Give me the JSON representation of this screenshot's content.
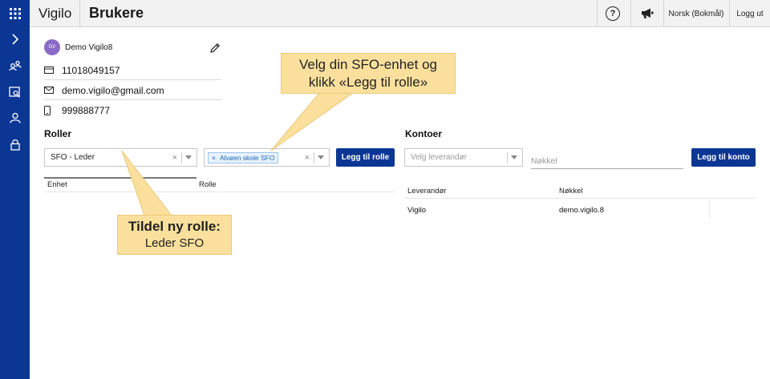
{
  "app": {
    "brand": "Vigilo",
    "page_title": "Brukere"
  },
  "topbar": {
    "help_label": "?",
    "language": "Norsk (Bokmål)",
    "logout": "Logg ut"
  },
  "profile": {
    "initials": "DV",
    "name": "Demo Vigilo8",
    "id_number": "11018049157",
    "email": "demo.vigilo@gmail.com",
    "phone": "999888777"
  },
  "roles": {
    "title": "Roller",
    "role_select": "SFO - Leder",
    "unit_tag": "Alvøen skole SFO",
    "tag_remove": "×",
    "clear_symbol": "×",
    "add_button": "Legg til rolle",
    "columns": [
      "Enhet",
      "Rolle"
    ]
  },
  "accounts": {
    "title": "Kontoer",
    "provider_placeholder": "Velg leverandør",
    "key_placeholder": "Nøkkel",
    "add_button": "Legg til konto",
    "columns": [
      "Leverandør",
      "Nøkkel"
    ],
    "rows": [
      {
        "provider": "Vigilo",
        "key": "demo.vigilo.8"
      }
    ]
  },
  "callouts": {
    "sfo_line1": "Velg din SFO-enhet og",
    "sfo_line2": "klikk «Legg til rolle»",
    "role_line1": "Tildel ny rolle:",
    "role_line2": "Leder SFO"
  },
  "colors": {
    "sidebar": "#0b3694",
    "primary_button": "#0b3694",
    "callout": "#fbe09d",
    "avatar": "#8b6bc8"
  }
}
